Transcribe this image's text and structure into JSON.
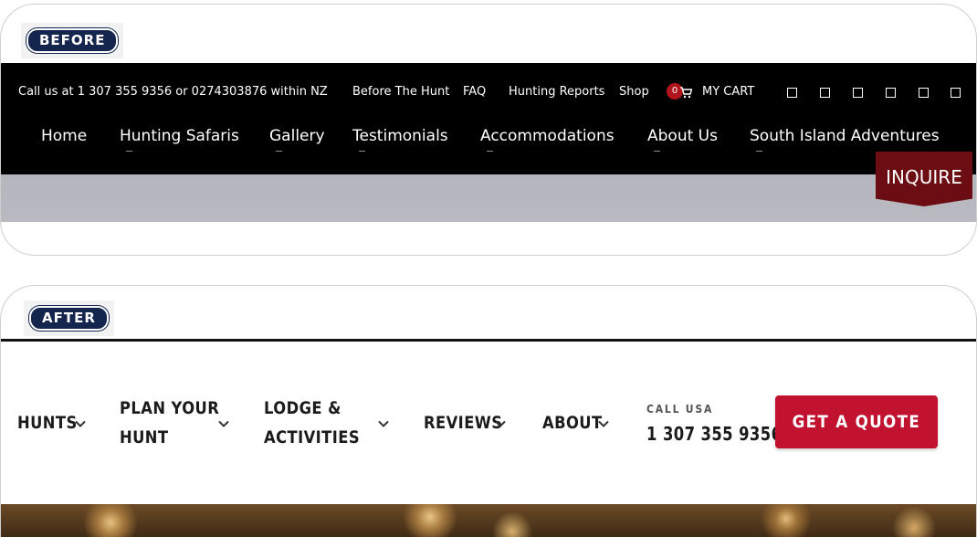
{
  "before": {
    "tag": "BEFORE",
    "utility": {
      "call_text": "Call us at 1 307 355 9356 or 0274303876 within NZ",
      "links": [
        "Before The Hunt",
        "FAQ",
        "Hunting Reports",
        "Shop"
      ],
      "cart_count": "0",
      "cart_label": "MY CART",
      "social_icons": [
        "square-icon",
        "square-icon",
        "square-icon",
        "square-icon",
        "square-icon",
        "square-icon"
      ]
    },
    "main_nav": [
      "Home",
      "Hunting Safaris",
      "Gallery",
      "Testimonials",
      "Accommodations",
      "About Us",
      "South Island Adventures"
    ],
    "inquire_label": "INQUIRE",
    "colors": {
      "bar": "#000000",
      "inquire": "#6b0d12",
      "badge": "#b2141b"
    }
  },
  "after": {
    "tag": "AFTER",
    "nav": [
      {
        "line1": "HUNTS",
        "line2": ""
      },
      {
        "line1": "PLAN YOUR",
        "line2": "HUNT"
      },
      {
        "line1": "LODGE &",
        "line2": "ACTIVITIES"
      },
      {
        "line1": "REVIEWS",
        "line2": ""
      },
      {
        "line1": "ABOUT",
        "line2": ""
      }
    ],
    "call_label": "CALL USA",
    "call_number": "1 307 355 9356",
    "cta_label": "GET A QUOTE",
    "colors": {
      "cta": "#c1122f",
      "tag": "#14254e"
    }
  }
}
